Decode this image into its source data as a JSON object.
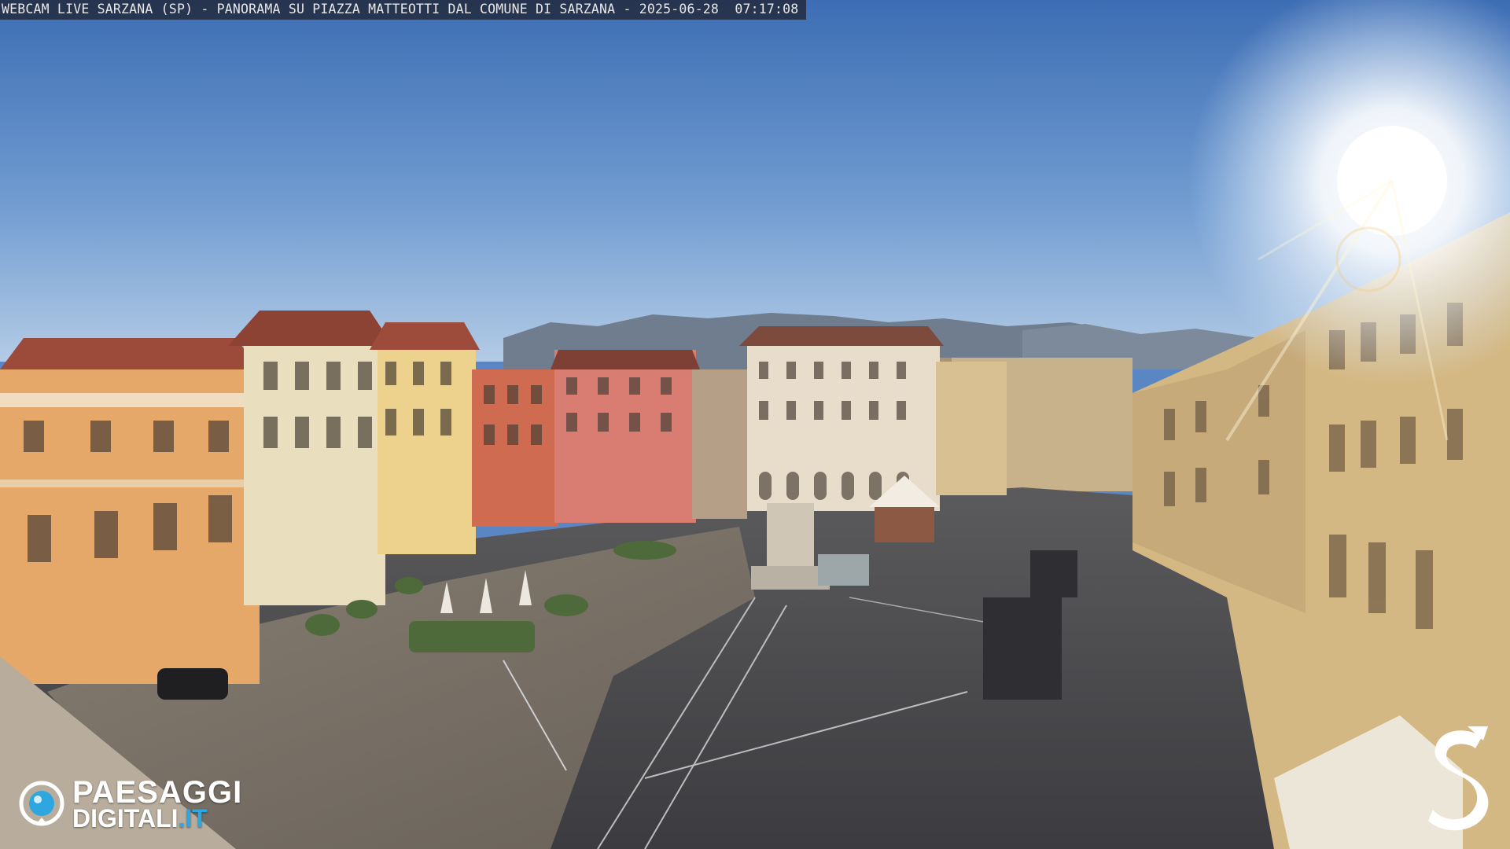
{
  "overlay": {
    "title": "WEBCAM LIVE SARZANA (SP) - PANORAMA SU PIAZZA MATTEOTTI DAL COMUNE DI SARZANA - 2025-06-28  07:17:08"
  },
  "logo_left": {
    "brand_line1": "PAESAGGI",
    "brand_line2": "DIGITALI",
    "brand_tld": ".IT",
    "accent_color": "#2ea7e0"
  },
  "logo_right": {
    "letter": "S"
  },
  "colors": {
    "sky_top": "#3f6fb5",
    "sky_bottom": "#a9c4e2",
    "sun": "#ffffff",
    "pavement": "#4a4a4e"
  }
}
